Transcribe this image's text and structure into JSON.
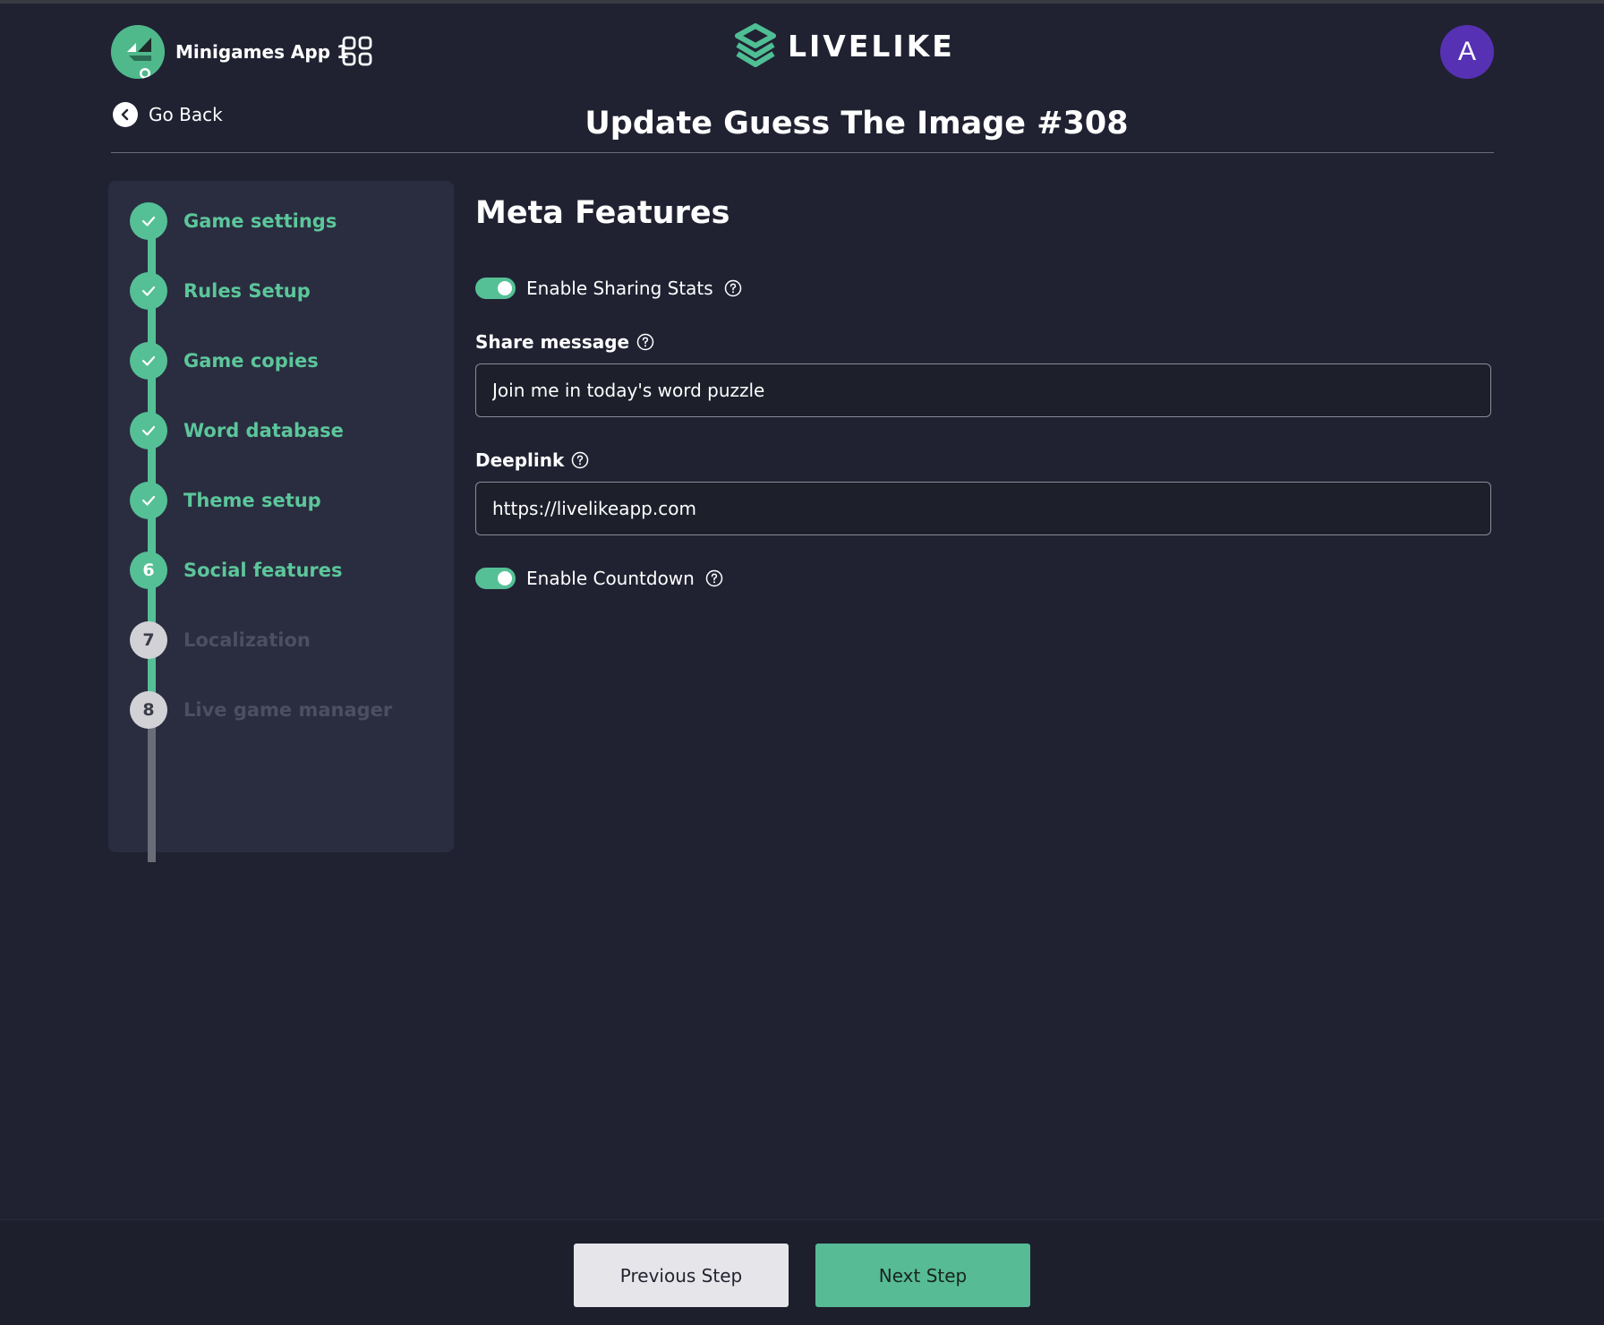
{
  "header": {
    "app_name": "Minigames App 1",
    "brand_name": "LIVELIKE",
    "avatar_initial": "A",
    "go_back_label": "Go Back",
    "page_title": "Update Guess The Image #308"
  },
  "stepper": {
    "current_step": 6,
    "steps": [
      {
        "label": "Game settings",
        "status": "completed",
        "marker": "check-icon"
      },
      {
        "label": "Rules Setup",
        "status": "completed",
        "marker": "check-icon"
      },
      {
        "label": "Game copies",
        "status": "completed",
        "marker": "check-icon"
      },
      {
        "label": "Word database",
        "status": "completed",
        "marker": "check-icon"
      },
      {
        "label": "Theme setup",
        "status": "completed",
        "marker": "check-icon"
      },
      {
        "label": "Social features",
        "status": "current",
        "number": "6"
      },
      {
        "label": "Localization",
        "status": "upcoming",
        "number": "7"
      },
      {
        "label": "Live game manager",
        "status": "upcoming",
        "number": "8"
      }
    ]
  },
  "main": {
    "section_title": "Meta Features",
    "sharing_toggle": {
      "label": "Enable Sharing Stats",
      "enabled": true
    },
    "share_message": {
      "label": "Share message",
      "value": "Join me in today's word puzzle"
    },
    "deeplink": {
      "label": "Deeplink",
      "value": "https://livelikeapp.com"
    },
    "countdown_toggle": {
      "label": "Enable Countdown",
      "enabled": true
    }
  },
  "footer": {
    "previous_label": "Previous Step",
    "next_label": "Next Step"
  },
  "colors": {
    "background": "#202232",
    "panel": "#2a2d40",
    "accent": "#55c096",
    "avatar": "#5731b4",
    "inactive_text": "#4c4f60"
  }
}
